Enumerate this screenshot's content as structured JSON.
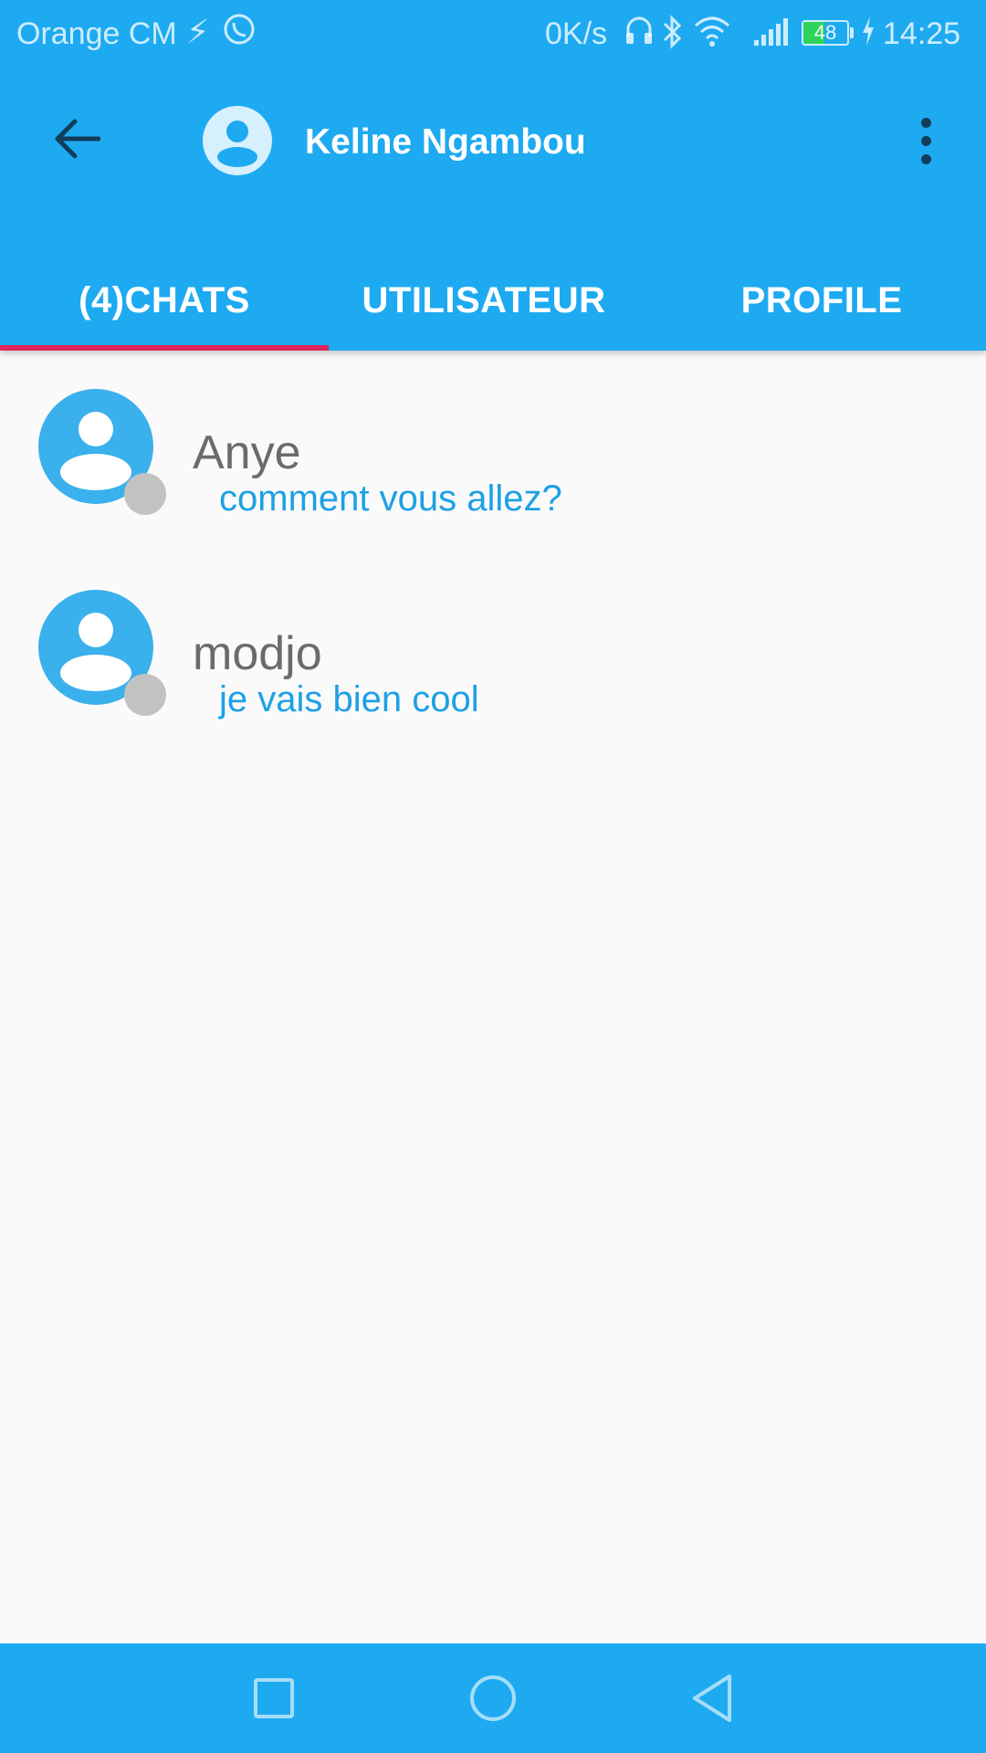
{
  "status_bar": {
    "carrier": "Orange CM",
    "usb_icon": "usb-icon",
    "call_icon": "wifi-call-icon",
    "network_speed": "0K/s",
    "battery_level": "48",
    "time": "14:25"
  },
  "app_bar": {
    "title": "Keline Ngambou",
    "back_icon": "arrow-back-icon",
    "menu_icon": "more-vert-icon"
  },
  "tabs": [
    {
      "label": "(4)CHATS",
      "selected": true
    },
    {
      "label": "UTILISATEUR",
      "selected": false
    },
    {
      "label": "PROFILE",
      "selected": false
    }
  ],
  "chats": [
    {
      "name": "Anye",
      "last_message": "comment vous allez?"
    },
    {
      "name": "modjo",
      "last_message": "je vais bien cool"
    }
  ],
  "colors": {
    "primary": "#1eaaf1",
    "accent": "#e0245e",
    "avatar": "#3ab0ec",
    "message_text": "#1da0e6",
    "presence_offline": "#c2c2c2"
  }
}
